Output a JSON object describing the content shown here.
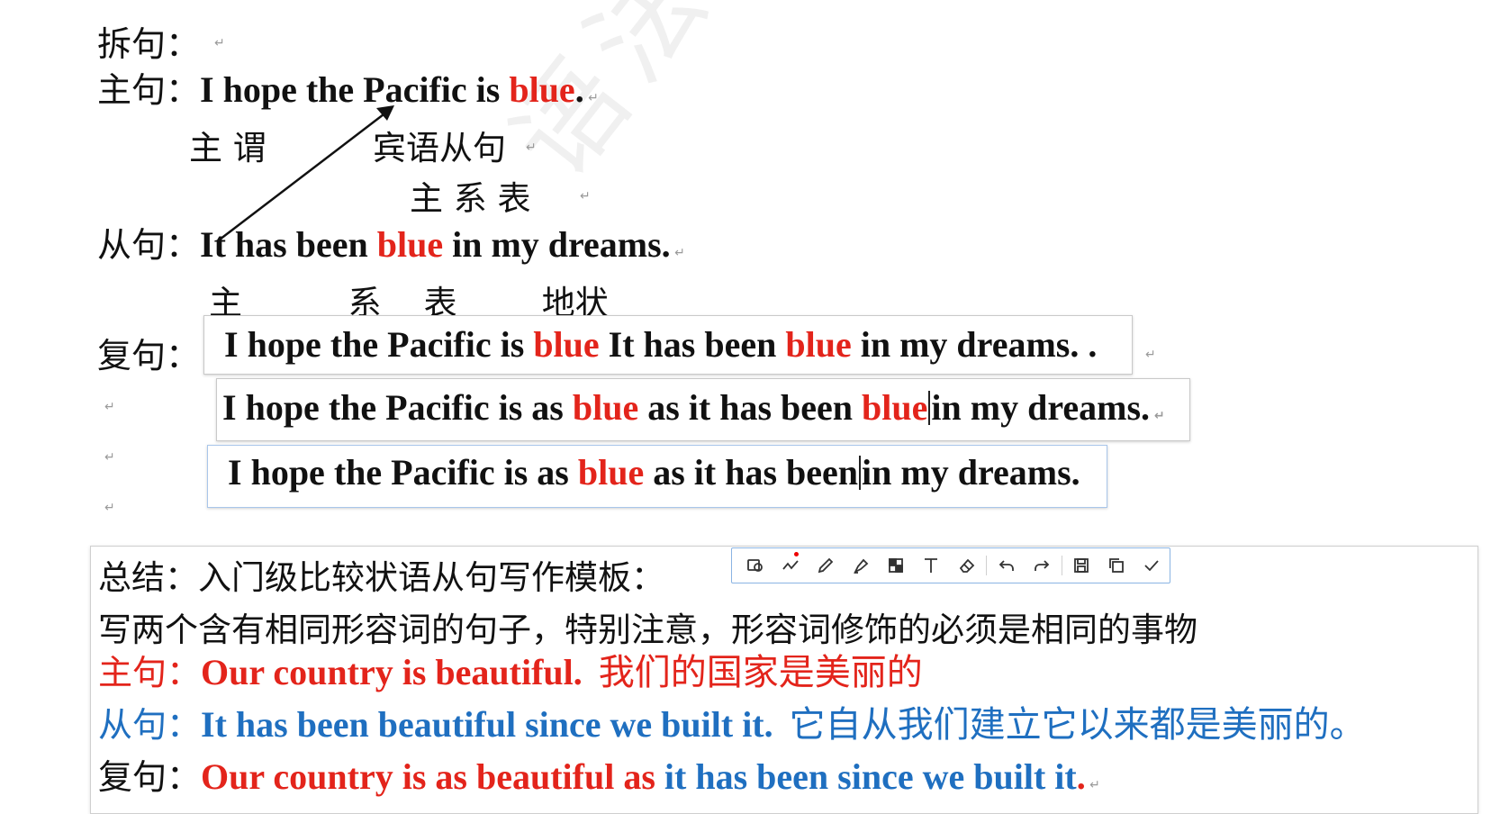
{
  "lines": {
    "chaiju_label": "拆句：",
    "main_label": "主句：",
    "main_sentence_a": "I hope the Pacific is ",
    "main_sentence_red": "blue",
    "main_sentence_b": ".",
    "main_annot_1": "主  谓",
    "main_annot_2": "宾语从句",
    "main_annot_3": "主    系  表",
    "clause_label": "从句：",
    "clause_a": "It has been ",
    "clause_red": "blue",
    "clause_b": " in my dreams.",
    "clause_annot": "主          系    表        地状",
    "complex_label": "复句："
  },
  "complex_boxes": {
    "box1_a": "I hope the Pacific is ",
    "box1_red1": "blue",
    "box1_b": " It has been ",
    "box1_red2": "blue",
    "box1_c": " in my dreams. .",
    "box2_a": "I hope the Pacific is as ",
    "box2_red1": "blue",
    "box2_b": " as it has been ",
    "box2_red2": "blue",
    "box2_c": "in my dreams.",
    "box3_a": "I hope the Pacific is as ",
    "box3_red": "blue",
    "box3_b": " as it has been",
    "box3_c": "in my dreams."
  },
  "summary": {
    "title": "总结：入门级比较状语从句写作模板：",
    "desc": "写两个含有相同形容词的句子，特别注意，形容词修饰的必须是相同的事物",
    "main_label": "主句：",
    "main_en": "Our country is beautiful.",
    "main_zh": "我们的国家是美丽的",
    "clause_label": "从句：",
    "clause_en": "It has been beautiful since we built it.",
    "clause_zh": "它自从我们建立它以来都是美丽的。",
    "complex_label": "复句：",
    "complex_red": "Our country is as beautiful as ",
    "complex_blue": "it has been since we built it",
    "complex_end": "."
  },
  "toolbar": {
    "tools": [
      "shape-icon",
      "freehand-line-icon",
      "pencil-icon",
      "highlighter-icon",
      "mosaic-icon",
      "text-icon",
      "eraser-icon",
      "undo-icon",
      "redo-icon",
      "save-icon",
      "copy-icon",
      "confirm-icon"
    ]
  },
  "watermark": "语法速成",
  "colors": {
    "red": "#e3241b",
    "blue": "#1f6fc0",
    "toolbar_border": "#8ab4e3"
  }
}
